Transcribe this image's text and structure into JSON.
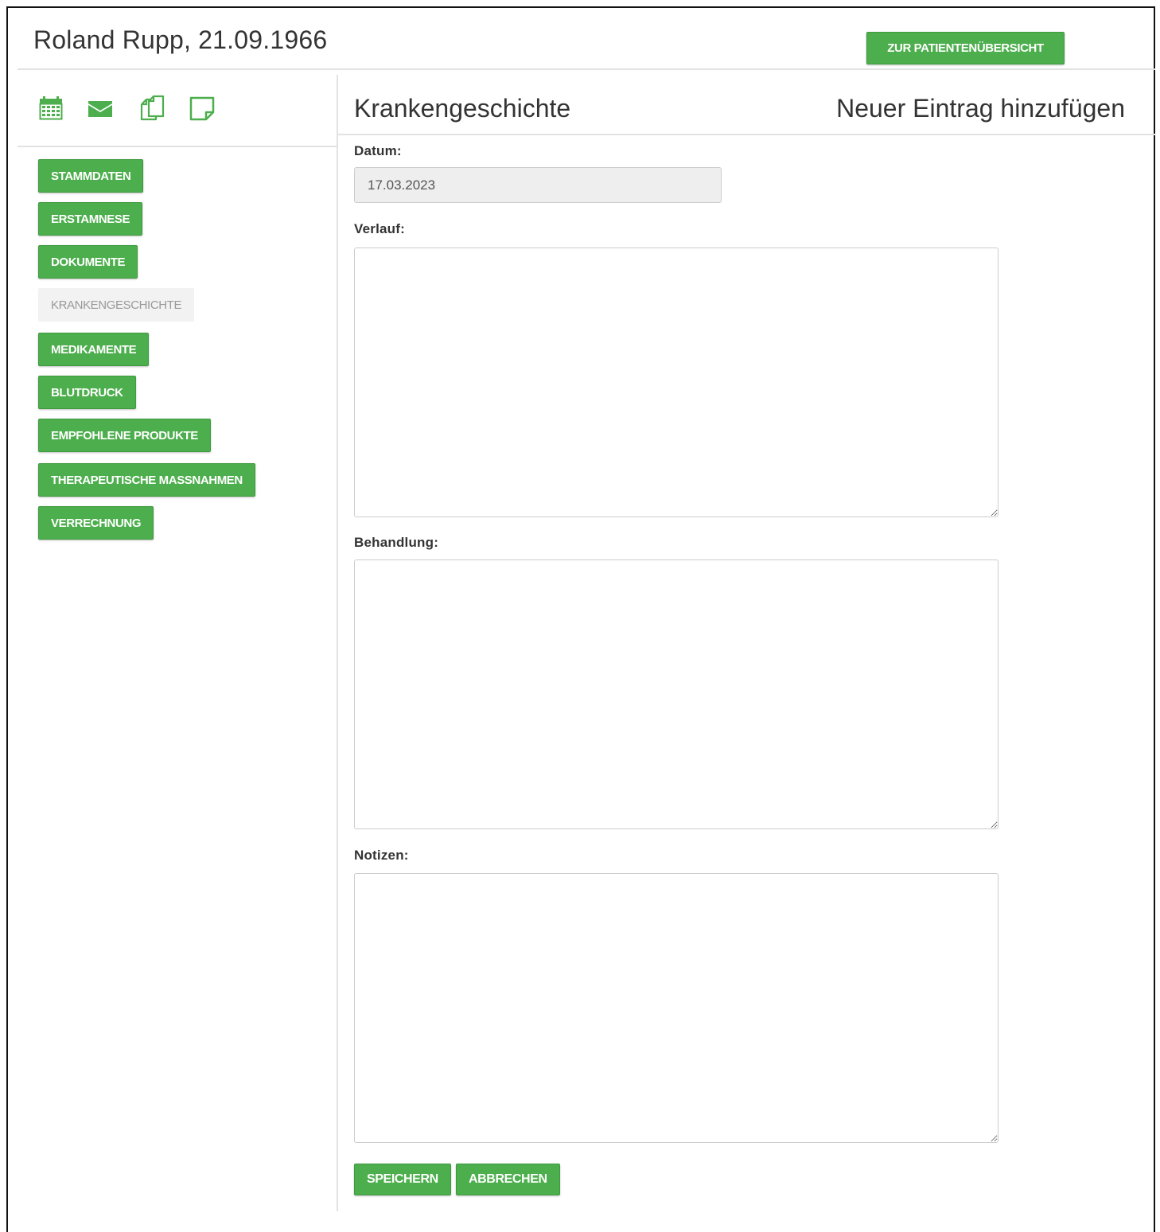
{
  "header": {
    "patient_name": "Roland Rupp, 21.09.1966",
    "overview_button": "ZUR PATIENTENÜBERSICHT"
  },
  "toolbar_icons": [
    {
      "name": "calendar-icon",
      "color": "#4cae4c"
    },
    {
      "name": "envelope-icon",
      "color": "#4cae4c"
    },
    {
      "name": "copy-icon",
      "color": "#4cae4c"
    },
    {
      "name": "note-icon",
      "color": "#4cae4c"
    }
  ],
  "sidebar": {
    "items": [
      {
        "label": "STAMMDATEN",
        "active": false
      },
      {
        "label": "ERSTAMNESE",
        "active": false
      },
      {
        "label": "DOKUMENTE",
        "active": false
      },
      {
        "label": "KRANKENGESCHICHTE",
        "active": true
      },
      {
        "label": "MEDIKAMENTE",
        "active": false
      },
      {
        "label": "BLUTDRUCK",
        "active": false
      },
      {
        "label": "EMPFOHLENE PRODUKTE",
        "active": false
      },
      {
        "label": "THERAPEUTISCHE MASSNAHMEN",
        "active": false
      },
      {
        "label": "VERRECHNUNG",
        "active": false
      }
    ]
  },
  "main": {
    "title": "Krankengeschichte",
    "subtitle": "Neuer Eintrag hinzufügen",
    "form": {
      "datum_label": "Datum:",
      "datum_value": "17.03.2023",
      "verlauf_label": "Verlauf:",
      "verlauf_value": "",
      "behandlung_label": "Behandlung:",
      "behandlung_value": "",
      "notizen_label": "Notizen:",
      "notizen_value": "",
      "save_button": "SPEICHERN",
      "cancel_button": "ABBRECHEN"
    }
  },
  "colors": {
    "accent": "#4cae4c",
    "active_nav_bg": "#f2f2f2",
    "active_nav_text": "#999999"
  }
}
